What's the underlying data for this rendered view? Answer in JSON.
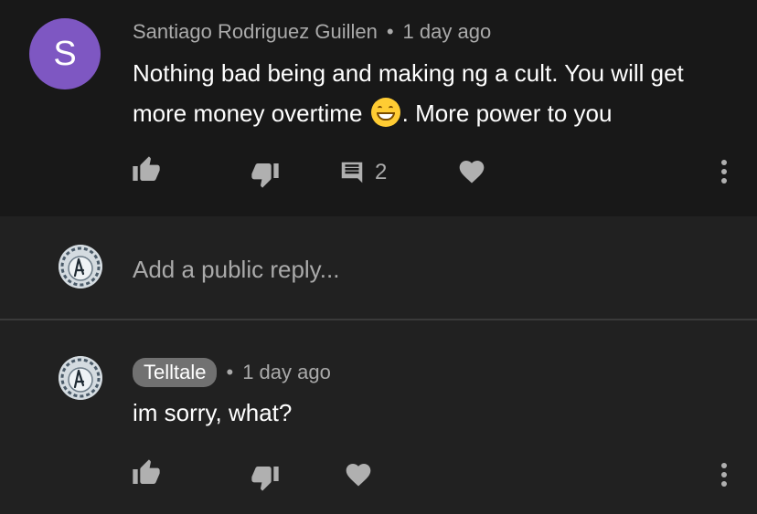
{
  "comment": {
    "avatar_letter": "S",
    "avatar_color": "#7e57c2",
    "author": "Santiago Rodriguez Guillen",
    "separator": "•",
    "time": "1 day ago",
    "text_line1": "Nothing bad being and making ng a cult. You will get",
    "text_line2_before": "more money overtime",
    "text_line2_after": ". More power to you",
    "emoji_icon": "grinning-face-emoji",
    "reply_count": "2"
  },
  "reply_box": {
    "placeholder": "Add a public reply..."
  },
  "reply": {
    "author": "Telltale",
    "separator": "•",
    "time": "1 day ago",
    "text": "im sorry, what?"
  },
  "icons": {
    "like": "thumbs-up-icon",
    "dislike": "thumbs-down-icon",
    "replies": "comment-icon",
    "heart": "heart-icon",
    "more": "more-vert-icon"
  }
}
